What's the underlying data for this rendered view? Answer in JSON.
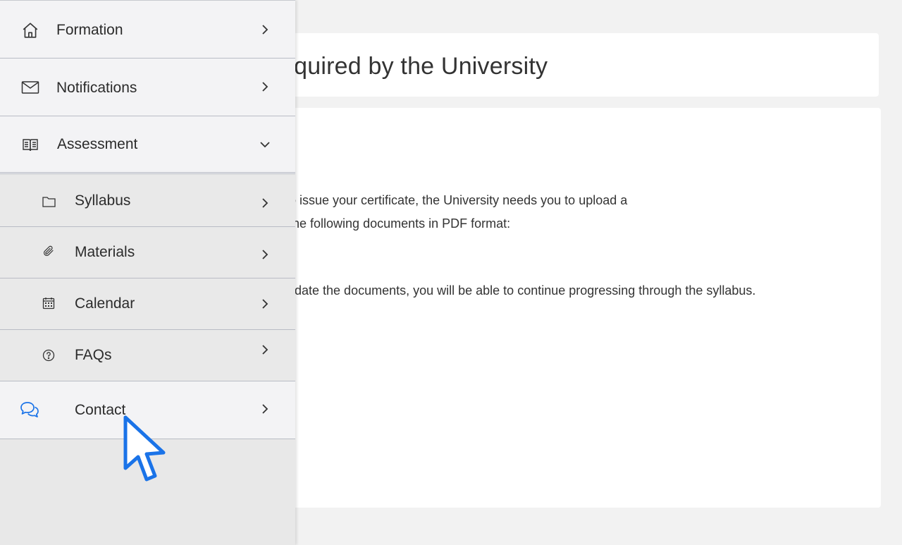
{
  "main": {
    "title": "equired by the University",
    "paragraph_line1": "o issue your certificate, the University needs you to upload a",
    "paragraph_line2": "the following documents in PDF format:",
    "paragraph_line3": "lidate the documents, you will be able to continue progressing through the syllabus."
  },
  "sidebar": {
    "items": [
      {
        "label": "Formation",
        "icon": "home-icon",
        "chevron": "right"
      },
      {
        "label": "Notifications",
        "icon": "envelope-icon",
        "chevron": "right"
      },
      {
        "label": "Assessment",
        "icon": "book-icon",
        "chevron": "down"
      },
      {
        "label": "Syllabus",
        "icon": "folder-icon",
        "chevron": "right"
      },
      {
        "label": "Materials",
        "icon": "paperclip-icon",
        "chevron": "right"
      },
      {
        "label": "Calendar",
        "icon": "calendar-icon",
        "chevron": "right"
      },
      {
        "label": "FAQs",
        "icon": "question-circle-icon",
        "chevron": "right"
      },
      {
        "label": "Contact",
        "icon": "chat-bubbles-icon",
        "chevron": "right"
      }
    ]
  },
  "colors": {
    "accent": "#1a73e8",
    "background": "#f2f2f2",
    "sidebar_top_bg": "#f3f3f5",
    "sidebar_sub_bg": "#e9e9e9",
    "divider": "#b9bcc5"
  }
}
